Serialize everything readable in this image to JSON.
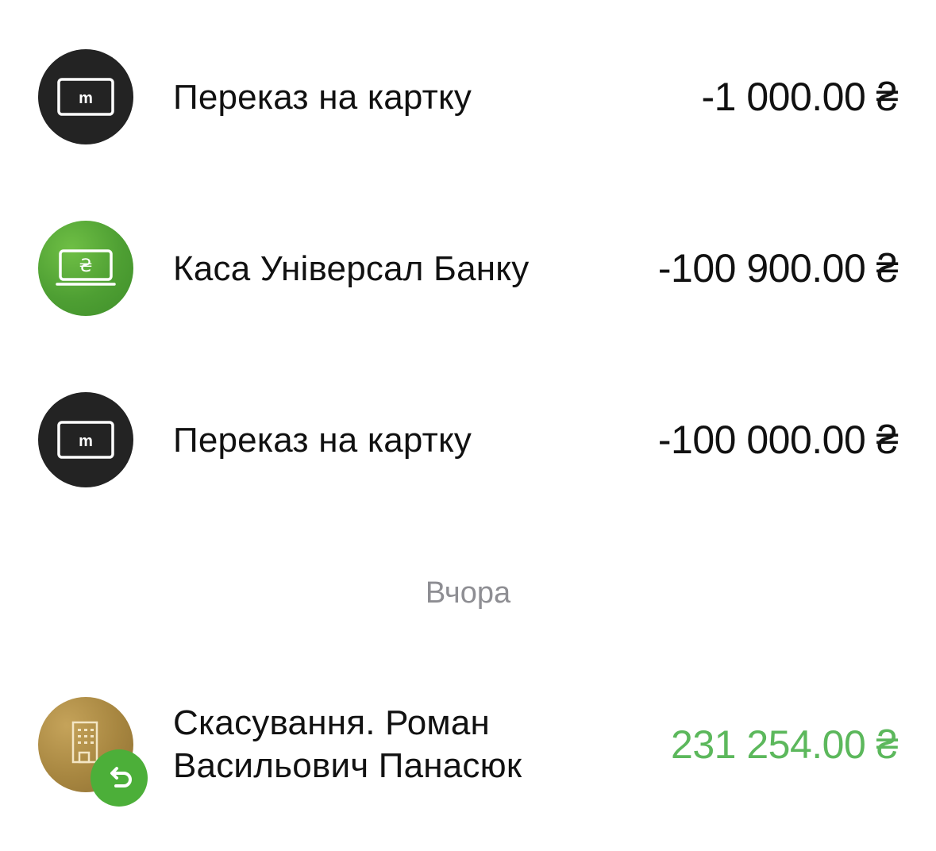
{
  "transactions_today": [
    {
      "title": "Переказ на картку",
      "amount": "-1 000.00 ₴",
      "icon": "card-m-icon"
    },
    {
      "title": "Каса Універсал Банку",
      "amount": "-100 900.00 ₴",
      "icon": "cash-desk-icon"
    },
    {
      "title": "Переказ на картку",
      "amount": "-100 000.00 ₴",
      "icon": "card-m-icon"
    }
  ],
  "section_yesterday": {
    "label": "Вчора"
  },
  "transactions_yesterday": [
    {
      "title_line1": "Скасування. Роман",
      "title_line2": "Васильович Панасюк",
      "amount": "231 254.00 ₴",
      "icon": "building-icon",
      "badge_icon": "return-arrow-icon"
    }
  ],
  "colors": {
    "dark_avatar": "#232323",
    "green_avatar": "#4e9f33",
    "gold_avatar": "#a78640",
    "positive_amount": "#5cb85c",
    "section_label": "#8e8e93"
  }
}
